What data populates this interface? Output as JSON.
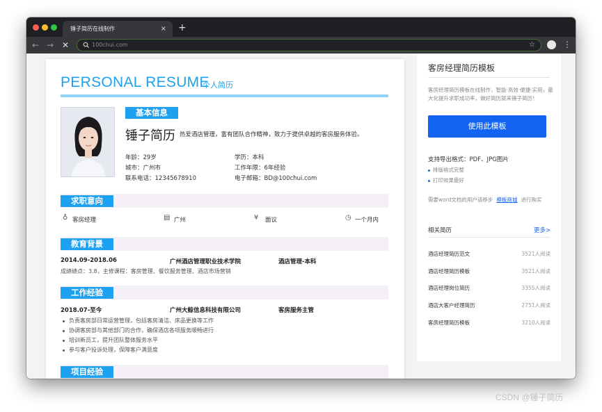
{
  "browser": {
    "tab_title": "锤子简历在线制作",
    "tab_close": "×",
    "new_tab": "+",
    "url": "100chui.com",
    "colors": {
      "close": "#ff5f57",
      "minimize": "#febc2e",
      "maximize": "#28c840"
    }
  },
  "resume": {
    "title": "PERSONAL RESUME",
    "subtitle": "个人简历",
    "basic": {
      "label": "基本信息",
      "name": "锤子简历",
      "tagline": "热爱酒店管理，富有团队合作精神，致力于提供卓越的客房服务体验。",
      "age": "年龄：29岁",
      "city": "城市：广州市",
      "phone": "联系电话：12345678910",
      "education": "学历：本科",
      "years": "工作年限：6年经验",
      "email": "电子邮箱：BD@100chui.com"
    },
    "intent": {
      "label": "求职意向",
      "position": "客房经理",
      "location": "广州",
      "salary": "面议",
      "availability": "一个月内"
    },
    "education": {
      "label": "教育背景",
      "period": "2014.09-2018.06",
      "school": "广州酒店管理职业技术学院",
      "major": "酒店管理-本科",
      "detail": "成绩绩点：3.8，主修课程：客房管理、餐饮服务管理、酒店市场营销"
    },
    "work": {
      "label": "工作经验",
      "period": "2018.07-至今",
      "company": "广州大鲸信息科技有限公司",
      "role": "客房服务主管",
      "bullets": [
        "负责客房部日常运营管理，包括客房清洁、床品更换等工作",
        "协调客房部与其他部门的合作，确保酒店各项服务顺畅进行",
        "培训新员工，提升团队整体服务水平",
        "参与客户投诉处理，保障客户满意度"
      ]
    },
    "project": {
      "label": "项目经验"
    }
  },
  "sidebar": {
    "title": "客房经理简历模板",
    "description": "客房经理简历模板在线制作，智能·高效·便捷·实用，最大化提升求职成功率，做好简历就来锤子简历！",
    "use_button": "使用此模板",
    "formats": "支持导出格式：PDF、JPG图片",
    "features": [
      "排版格式完整",
      "打印效果最好"
    ],
    "word_prefix": "需要word文档的用户请移步",
    "word_link": "模板商城",
    "word_suffix": "进行购买",
    "related_title": "相关简历",
    "related_more": "更多>",
    "related": [
      {
        "name": "酒店经理简历范文",
        "count": "3521人阅读"
      },
      {
        "name": "酒店经理简历模板",
        "count": "3521人阅读"
      },
      {
        "name": "酒店经理岗位简历",
        "count": "3355人阅读"
      },
      {
        "name": "酒店大客户经理简历",
        "count": "2751人阅读"
      },
      {
        "name": "客房经理简历模板",
        "count": "3210人阅读"
      }
    ]
  },
  "watermark": "CSDN @锤子简历"
}
